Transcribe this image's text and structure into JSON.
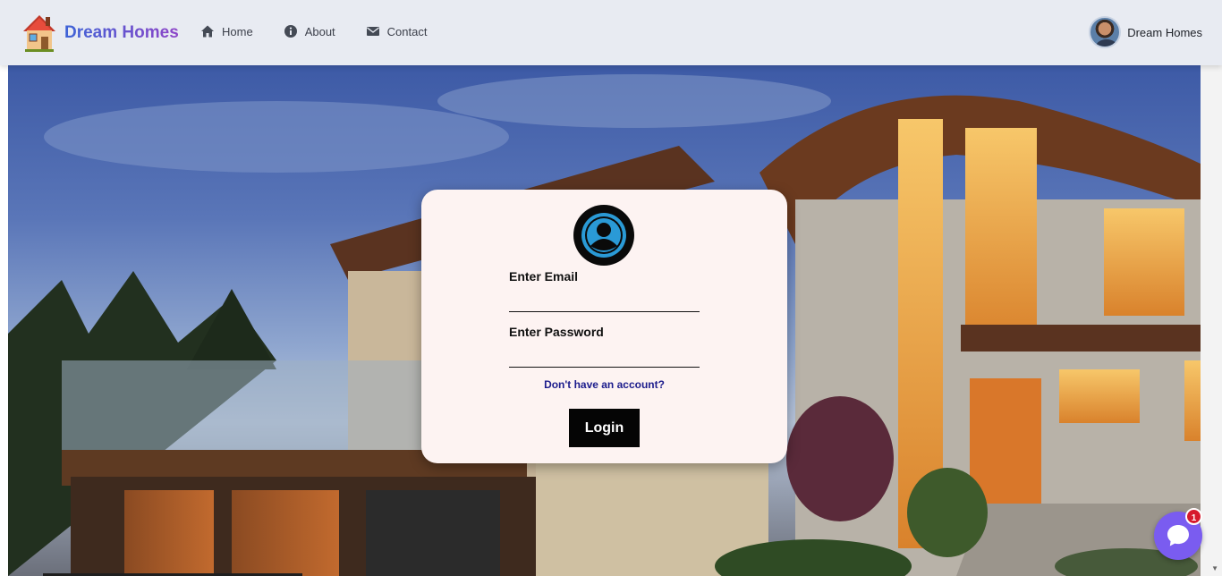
{
  "navbar": {
    "brand_name": "Dream Homes",
    "links": [
      {
        "label": "Home",
        "icon": "home-icon"
      },
      {
        "label": "About",
        "icon": "info-icon"
      },
      {
        "label": "Contact",
        "icon": "envelope-icon"
      }
    ],
    "user_name": "Dream Homes"
  },
  "login": {
    "email_label": "Enter Email",
    "password_label": "Enter Password",
    "signup_link": "Don't have an account?",
    "submit_label": "Login"
  },
  "chat_widget": {
    "badge_count": "1",
    "icon": "chat-bubble-icon"
  },
  "colors": {
    "brand_gradient_start": "#3d63d6",
    "brand_gradient_end": "#8e45c8",
    "card_background": "#fdf3f2",
    "button_background": "#050505",
    "link_color": "#1c1c8c",
    "chat_widget": "#7a5cf0",
    "chat_badge": "#d61a2c"
  }
}
